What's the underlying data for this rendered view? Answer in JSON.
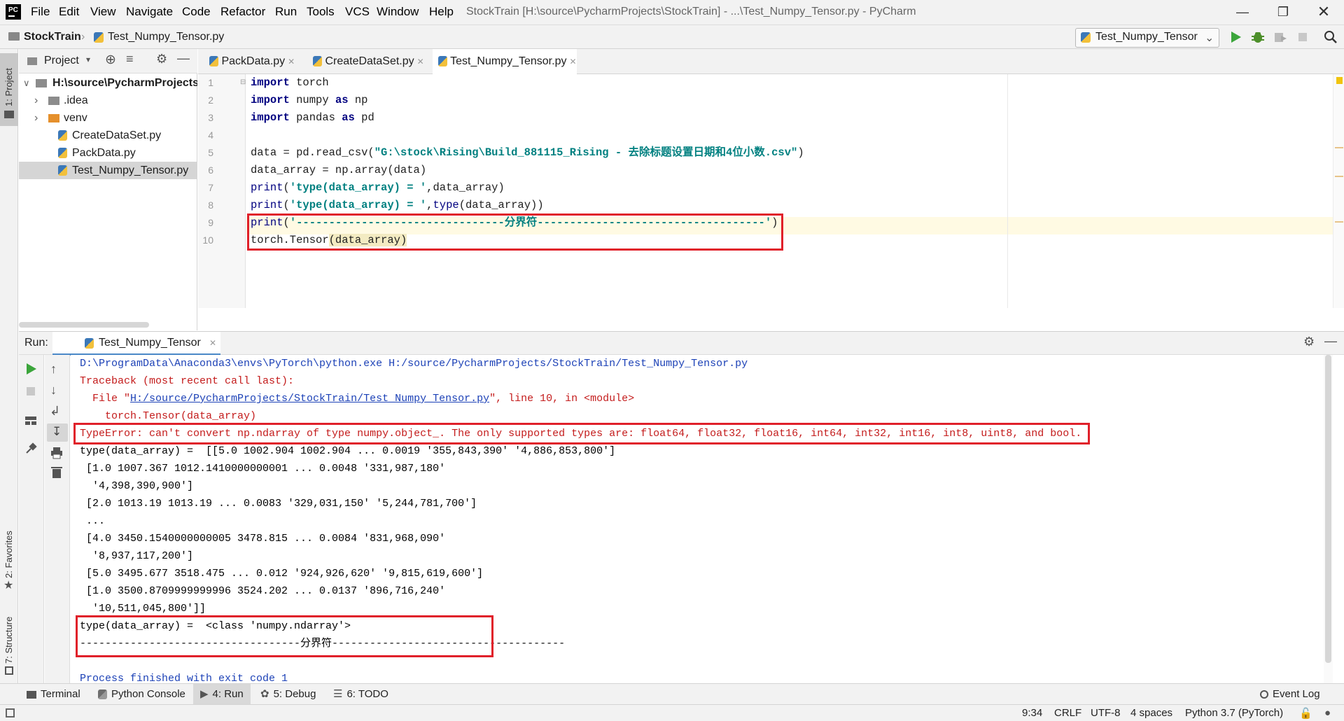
{
  "titlebar": {
    "menus": [
      "File",
      "Edit",
      "View",
      "Navigate",
      "Code",
      "Refactor",
      "Run",
      "Tools",
      "VCS",
      "Window",
      "Help"
    ],
    "window_title": "StockTrain [H:\\source\\PycharmProjects\\StockTrain] - ...\\Test_Numpy_Tensor.py - PyCharm"
  },
  "navbar": {
    "project": "StockTrain",
    "file": "Test_Numpy_Tensor.py",
    "run_config": "Test_Numpy_Tensor"
  },
  "left_stripe": {
    "project_tab": "1: Project",
    "favorites_tab": "2: Favorites",
    "structure_tab": "7: Structure"
  },
  "project_panel": {
    "title": "Project",
    "root": "H:\\source\\PycharmProjects\\",
    "items": [
      ".idea",
      "venv",
      "CreateDataSet.py",
      "PackData.py",
      "Test_Numpy_Tensor.py"
    ]
  },
  "editor": {
    "tabs": [
      "PackData.py",
      "CreateDataSet.py",
      "Test_Numpy_Tensor.py"
    ],
    "line_numbers": [
      "1",
      "2",
      "3",
      "4",
      "5",
      "6",
      "7",
      "8",
      "9",
      "10"
    ],
    "code": {
      "l1_kw": "import",
      "l1_rest": " torch",
      "l2_kw": "import",
      "l2_mid": " numpy ",
      "l2_kw2": "as",
      "l2_rest": " np",
      "l3_kw": "import",
      "l3_mid": " pandas ",
      "l3_kw2": "as",
      "l3_rest": " pd",
      "l5_a": "data = pd.read_csv(",
      "l5_str": "\"G:\\stock\\Rising\\Build_881115_Rising - 去除标题设置日期和4位小数.csv\"",
      "l5_b": ")",
      "l6": "data_array = np.array(data)",
      "l7_fn": "print",
      "l7_a": "(",
      "l7_str": "'type(data_array) = '",
      "l7_b": ",data_array)",
      "l8_fn": "print",
      "l8_a": "(",
      "l8_str": "'type(data_array) = '",
      "l8_b": ",",
      "l8_fn2": "type",
      "l8_c": "(data_array))",
      "l9_fn": "print",
      "l9_a": "(",
      "l9_str": "'--------------------------------分界符-----------------------------------'",
      "l9_b": ")",
      "l10_a": "torch.Tensor",
      "l10_b": "(data_array)"
    }
  },
  "run": {
    "label": "Run:",
    "tab": "Test_Numpy_Tensor",
    "lines": {
      "cmd": "D:\\ProgramData\\Anaconda3\\envs\\PyTorch\\python.exe H:/source/PycharmProjects/StockTrain/Test_Numpy_Tensor.py",
      "tb": "Traceback (most recent call last):",
      "file_pre": "  File \"",
      "file_link": "H:/source/PycharmProjects/StockTrain/Test_Numpy_Tensor.py",
      "file_post": "\", line 10, in <module>",
      "code_line": "    torch.Tensor(data_array)",
      "typeerror": "TypeError: can't convert np.ndarray of type numpy.object_. The only supported types are: float64, float32, float16, int64, int32, int16, int8, uint8, and bool.",
      "o1": "type(data_array) =  [[5.0 1002.904 1002.904 ... 0.0019 '355,843,390' '4,886,853,800']",
      "o2": " [1.0 1007.367 1012.1410000000001 ... 0.0048 '331,987,180'",
      "o3": "  '4,398,390,900']",
      "o4": " [2.0 1013.19 1013.19 ... 0.0083 '329,031,150' '5,244,781,700']",
      "o5": " ...",
      "o6": " [4.0 3450.1540000000005 3478.815 ... 0.0084 '831,968,090'",
      "o7": "  '8,937,117,200']",
      "o8": " [5.0 3495.677 3518.475 ... 0.012 '924,926,620' '9,815,619,600']",
      "o9": " [1.0 3500.8709999999996 3524.202 ... 0.0137 '896,716,240'",
      "o10": "  '10,511,045,800']]",
      "o11": "type(data_array) =  <class 'numpy.ndarray'>",
      "o12": "-----------------------------------分界符-------------------------------------",
      "blank": "",
      "exit": "Process finished with exit code 1"
    }
  },
  "bottom_bar": {
    "terminal": "Terminal",
    "python_console": "Python Console",
    "run": "4: Run",
    "debug": "5: Debug",
    "todo": "6: TODO",
    "event_log": "Event Log"
  },
  "status_bar": {
    "position": "9:34",
    "line_sep": "CRLF",
    "encoding": "UTF-8",
    "indent": "4 spaces",
    "interpreter": "Python 3.7 (PyTorch)"
  },
  "colors": {
    "error": "#c41c1c",
    "highlight_box": "#e0202a",
    "keyword": "#000080",
    "string": "#008080",
    "active_tab_underline": "#4a88c7"
  }
}
